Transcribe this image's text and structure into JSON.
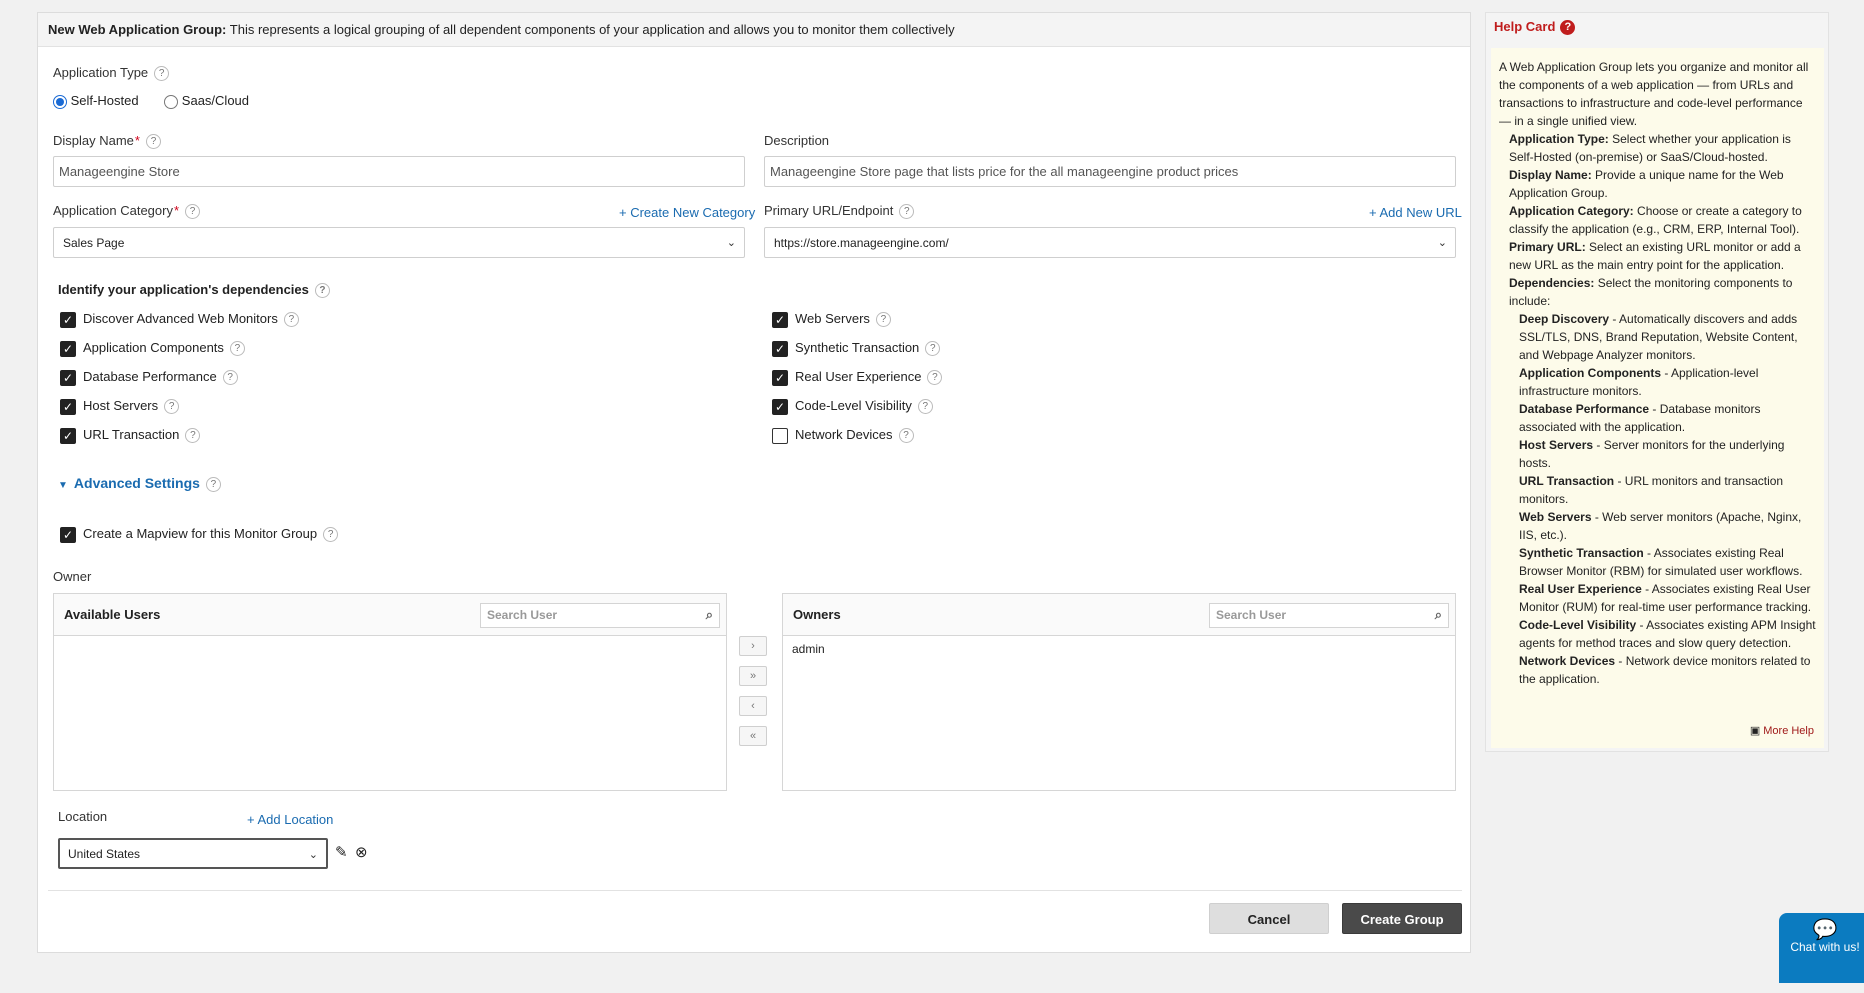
{
  "header": {
    "title": "New Web Application Group:",
    "description": "This represents a logical grouping of all dependent components of your application and allows you to monitor them collectively"
  },
  "app_type": {
    "label": "Application Type",
    "options": [
      "Self-Hosted",
      "Saas/Cloud"
    ],
    "selected": "Self-Hosted"
  },
  "display_name": {
    "label": "Display Name",
    "value": "Manageengine Store"
  },
  "description": {
    "label": "Description",
    "value": "Manageengine Store page that lists price for the all manageengine product prices"
  },
  "category": {
    "label": "Application Category",
    "create_link": "+ Create New Category",
    "value": "Sales Page"
  },
  "primary_url": {
    "label": "Primary URL/Endpoint",
    "add_link": "+ Add New URL",
    "value": "https://store.manageengine.com/"
  },
  "dependencies": {
    "title": "Identify your application's dependencies",
    "left": [
      {
        "label": "Discover Advanced Web Monitors",
        "checked": true
      },
      {
        "label": "Application Components",
        "checked": true
      },
      {
        "label": "Database Performance",
        "checked": true
      },
      {
        "label": "Host Servers",
        "checked": true
      },
      {
        "label": "URL Transaction",
        "checked": true
      }
    ],
    "right": [
      {
        "label": "Web Servers",
        "checked": true
      },
      {
        "label": "Synthetic Transaction",
        "checked": true
      },
      {
        "label": "Real User Experience",
        "checked": true
      },
      {
        "label": "Code-Level Visibility",
        "checked": true
      },
      {
        "label": "Network Devices",
        "checked": false
      }
    ]
  },
  "advanced": {
    "label": "Advanced Settings",
    "mapview_label": "Create a Mapview for this Monitor Group",
    "mapview_checked": true
  },
  "owner": {
    "label": "Owner",
    "available_title": "Available Users",
    "owners_title": "Owners",
    "search_placeholder": "Search User",
    "owners": [
      "admin"
    ],
    "move_buttons": [
      "›",
      "»",
      "‹",
      "«"
    ]
  },
  "location": {
    "label": "Location",
    "add_link": "+ Add Location",
    "value": "United States"
  },
  "actions": {
    "cancel": "Cancel",
    "create": "Create Group"
  },
  "help_card": {
    "title": "Help Card",
    "intro": "A Web Application Group lets you organize and monitor all the components of a web application — from URLs and transactions to infrastructure and code-level performance — in a single unified view.",
    "items": [
      {
        "term": "Application Type:",
        "text": " Select whether your application is Self-Hosted (on-premise) or SaaS/Cloud-hosted.",
        "level": 1
      },
      {
        "term": "Display Name:",
        "text": " Provide a unique name for the Web Application Group.",
        "level": 1
      },
      {
        "term": "Application Category:",
        "text": " Choose or create a category to classify the application (e.g., CRM, ERP, Internal Tool).",
        "level": 1
      },
      {
        "term": "Primary URL:",
        "text": " Select an existing URL monitor or add a new URL as the main entry point for the application.",
        "level": 1
      },
      {
        "term": "Dependencies:",
        "text": " Select the monitoring components to include:",
        "level": 1
      },
      {
        "term": "Deep Discovery",
        "text": " - Automatically discovers and adds SSL/TLS, DNS, Brand Reputation, Website Content, and Webpage Analyzer monitors.",
        "level": 2
      },
      {
        "term": "Application Components",
        "text": " - Application-level infrastructure monitors.",
        "level": 2
      },
      {
        "term": "Database Performance",
        "text": " - Database monitors associated with the application.",
        "level": 2
      },
      {
        "term": "Host Servers",
        "text": " - Server monitors for the underlying hosts.",
        "level": 2
      },
      {
        "term": "URL Transaction",
        "text": " - URL monitors and transaction monitors.",
        "level": 2
      },
      {
        "term": "Web Servers",
        "text": " - Web server monitors (Apache, Nginx, IIS, etc.).",
        "level": 2
      },
      {
        "term": "Synthetic Transaction",
        "text": " - Associates existing Real Browser Monitor (RBM) for simulated user workflows.",
        "level": 2
      },
      {
        "term": "Real User Experience",
        "text": " - Associates existing Real User Monitor (RUM) for real-time user performance tracking.",
        "level": 2
      },
      {
        "term": "Code-Level Visibility",
        "text": " - Associates existing APM Insight agents for method traces and slow query detection.",
        "level": 2
      },
      {
        "term": "Network Devices",
        "text": " - Network device monitors related to the application.",
        "level": 2
      }
    ],
    "more_help": "More Help"
  },
  "chat": {
    "label": "Chat with us!"
  },
  "colors": {
    "link": "#1a6bb0",
    "help_title": "#c01d1d",
    "chat_bg": "#0b7bc0",
    "create_btn": "#4a4a4a"
  }
}
